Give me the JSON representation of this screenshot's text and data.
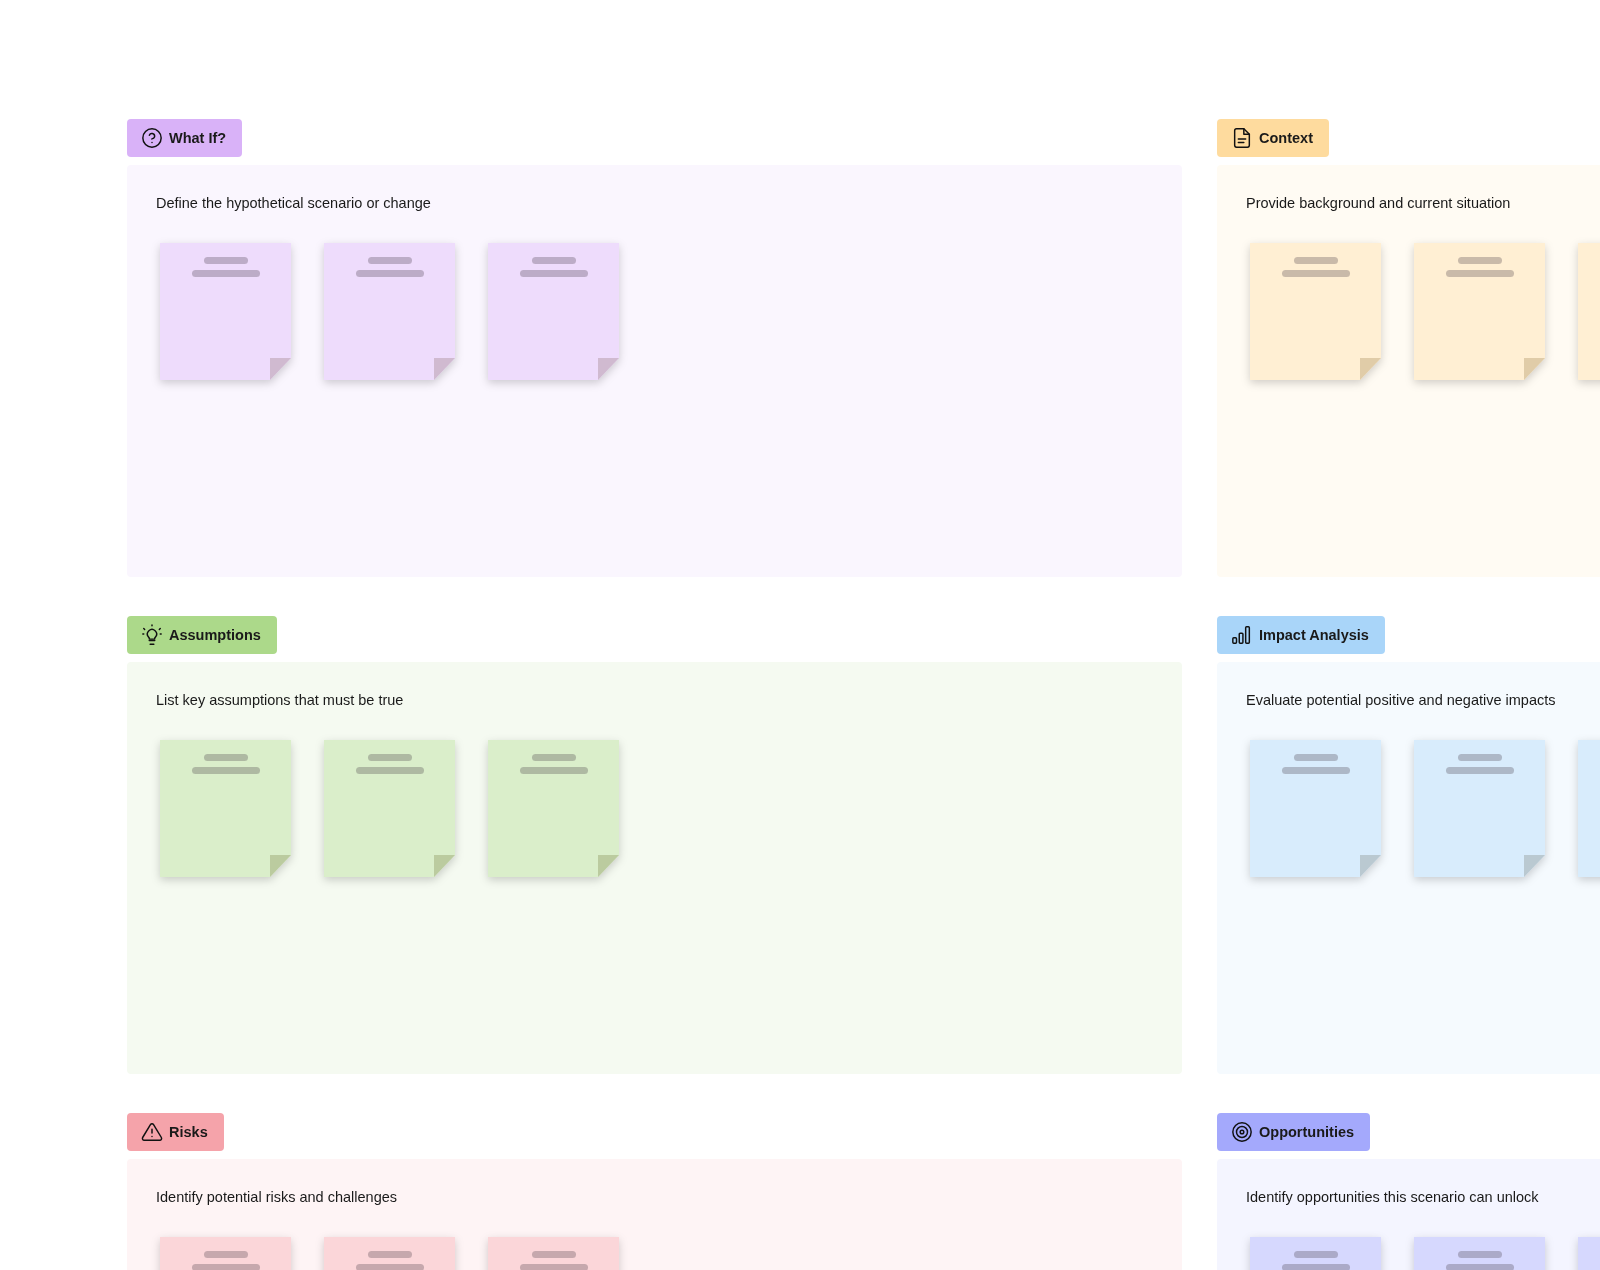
{
  "sections": [
    {
      "title": "What If?",
      "color": "#d9b2f8",
      "description": "Define the hypothetical scenario or change"
    },
    {
      "title": "Context",
      "color": "#fedb9e",
      "description": "Provide background and current situation"
    },
    {
      "title": "Assumptions",
      "color": "#acd98a",
      "description": "List key assumptions that must be true"
    },
    {
      "title": "Impact Analysis",
      "color": "#a9d5f9",
      "description": "Evaluate potential positive and negative impacts"
    },
    {
      "title": "Risks",
      "color": "#f5a3aa",
      "description": "Identify potential risks and challenges"
    },
    {
      "title": "Opportunities",
      "color": "#a4a9fc",
      "description": "Identify opportunities this scenario can unlock"
    }
  ]
}
